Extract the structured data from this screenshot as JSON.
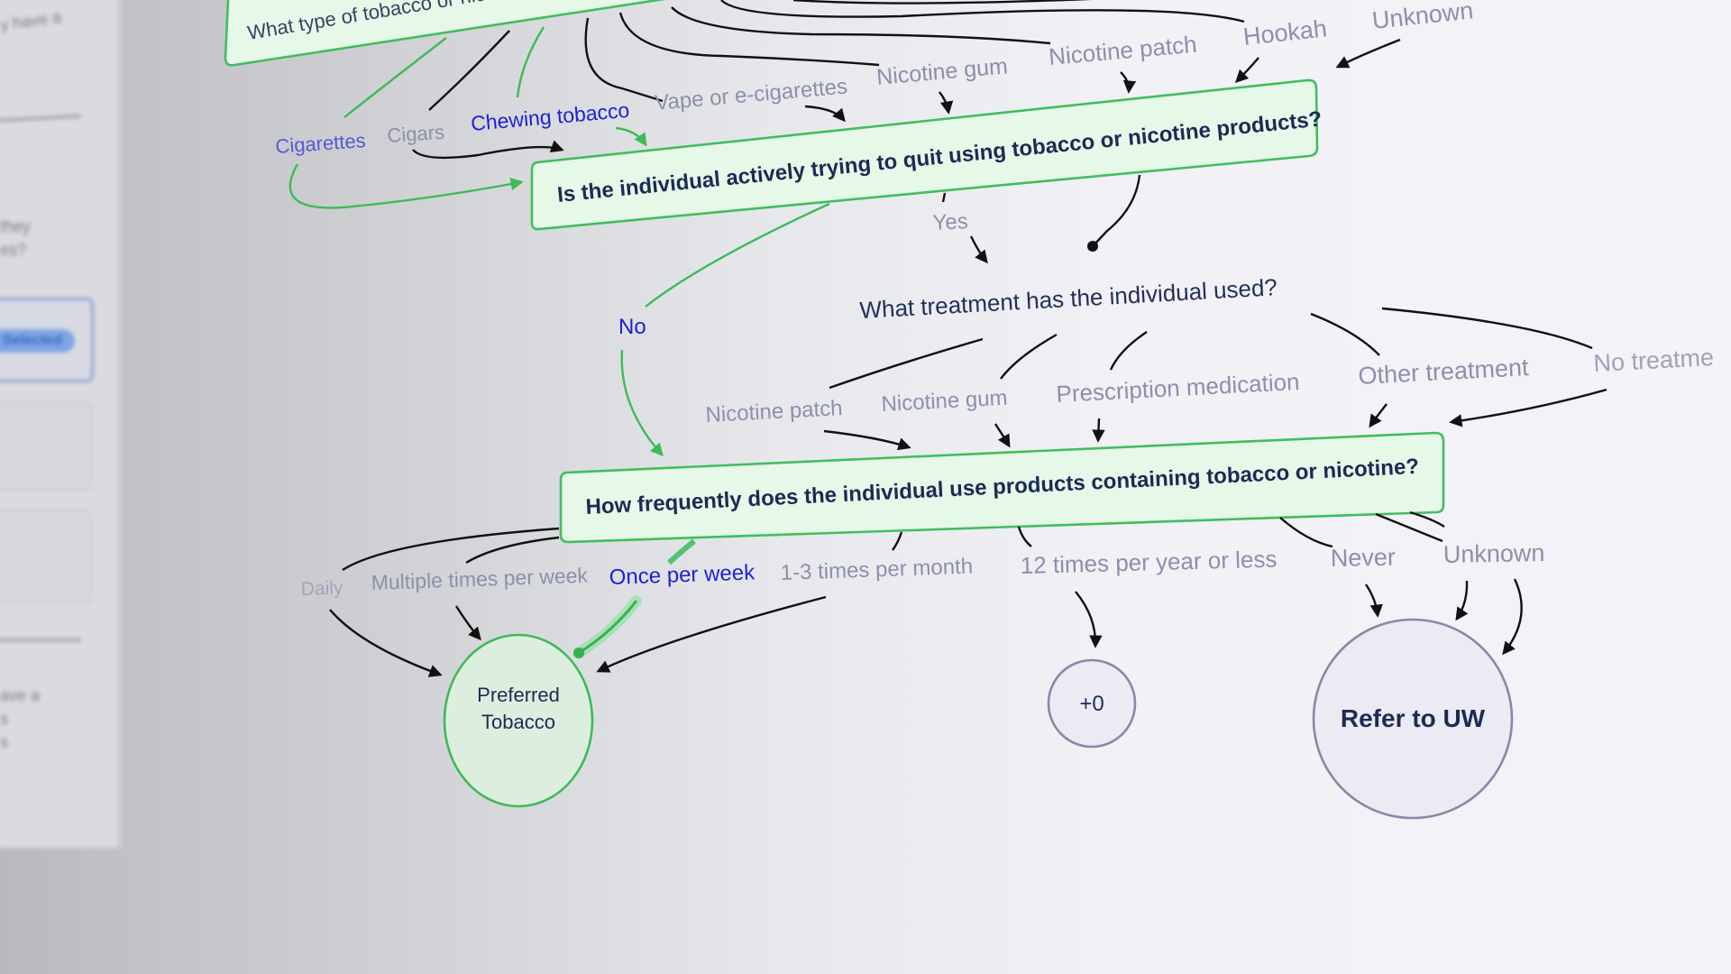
{
  "side_panel": {
    "fragments": [
      "y have a",
      "they",
      "es?",
      "ave a",
      "s",
      "s"
    ],
    "selected_badge": "Selected"
  },
  "flowchart": {
    "q1": {
      "text": "What type of tobacco or nicotine ha",
      "options": [
        "Cigarettes",
        "Cigars",
        "Chewing tobacco",
        "Vape or e-cigarettes",
        "Nicotine gum",
        "Nicotine patch",
        "Hookah",
        "Unknown"
      ],
      "selected": [
        "Cigarettes",
        "Chewing tobacco"
      ]
    },
    "q2": {
      "text": "Is the individual actively trying to quit using tobacco or nicotine products?",
      "options": [
        "Yes",
        "No"
      ],
      "selected": "No"
    },
    "q3": {
      "text": "What treatment has the individual used?",
      "options": [
        "Nicotine patch",
        "Nicotine gum",
        "Prescription medication",
        "Other treatment",
        "No treatme"
      ]
    },
    "q4": {
      "text": "How frequently does the individual use products containing tobacco or nicotine?",
      "options": [
        "Daily",
        "Multiple times per week",
        "Once per week",
        "1-3 times per month",
        "12 times per year or less",
        "Never",
        "Unknown"
      ],
      "selected": "Once per week"
    },
    "results": {
      "preferred_line1": "Preferred",
      "preferred_line2": "Tobacco",
      "zero": "+0",
      "refer": "Refer to UW"
    }
  },
  "colors": {
    "accent_green": "#42bd5e",
    "selected_blue": "#1c22d6",
    "option_gray": "#8d8fab",
    "question_navy": "#1d2a55"
  }
}
